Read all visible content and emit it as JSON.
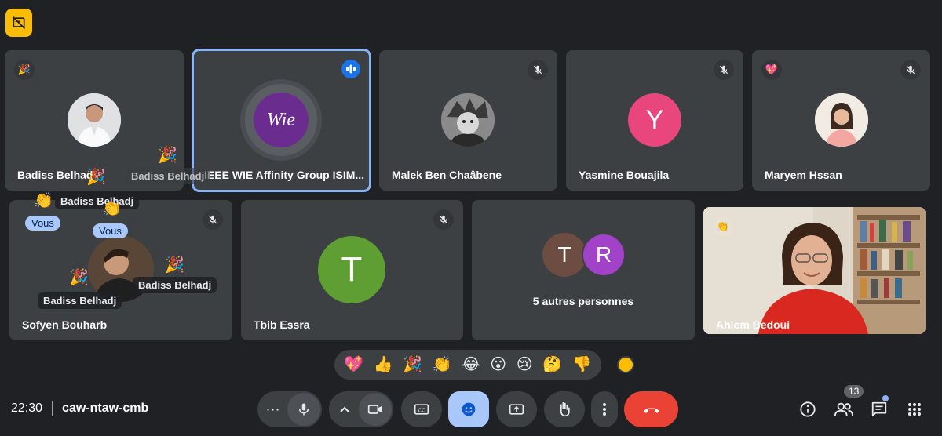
{
  "meeting": {
    "time": "22:30",
    "code": "caw-ntaw-cmb"
  },
  "participants": {
    "badiss": {
      "name": "Badiss Belhadj"
    },
    "ieee": {
      "name": "IEEE WIE Affinity Group ISIM...",
      "logo_text": "Wie"
    },
    "malek": {
      "name": "Malek Ben Chaâbene"
    },
    "yasmine": {
      "name": "Yasmine Bouajila",
      "initial": "Y"
    },
    "maryem": {
      "name": "Maryem Hssan"
    },
    "sofyen": {
      "name": "Sofyen Bouharb"
    },
    "tbib": {
      "name": "Tbib Essra",
      "initial": "T"
    },
    "others": {
      "label": "5 autres personnes",
      "initials": [
        "T",
        "R"
      ]
    },
    "ahlem": {
      "name": "Ahlem Bedoui"
    }
  },
  "overlays": {
    "floating_name": "Badiss Belhadj",
    "you_label": "Vous"
  },
  "reactions": [
    "💖",
    "👍",
    "🎉",
    "👏",
    "😂",
    "😮",
    "😢",
    "🤔",
    "👎"
  ],
  "people_count": "13",
  "colors": {
    "background": "#202124",
    "tile": "#3c4043",
    "accent_blue": "#8ab4f8",
    "end_call_red": "#ea4335",
    "yasmine_avatar": "#e8467c",
    "tbib_avatar": "#5f9e32",
    "t_avatar": "#6d4c41",
    "r_avatar": "#a142c8",
    "badge_yellow": "#fbbc04"
  },
  "icons": {
    "top_left": "cast-off-icon",
    "muted": "mic-off-icon",
    "speaking": "audio-level-icon",
    "controls": [
      "more-horiz-icon",
      "mic-icon",
      "chevron-up-icon",
      "videocam-icon",
      "captions-icon",
      "emoji-icon",
      "present-icon",
      "raise-hand-icon",
      "more-vert-icon",
      "call-end-icon"
    ],
    "right": [
      "info-icon",
      "people-icon",
      "chat-icon",
      "apps-icon"
    ]
  }
}
